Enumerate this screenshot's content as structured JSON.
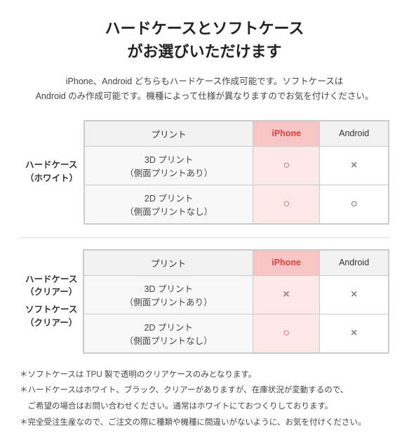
{
  "title": {
    "line1": "ハードケースとソフトケース",
    "line2": "がお選びいただけます"
  },
  "subtitle": "iPhone、Android どちらもハードケース作成可能です。ソフトケースは\nAndroid のみ作成可能です。機種によって仕様が異なりますのでお気を付けください。",
  "section1": {
    "row_header_line1": "ハードケース",
    "row_header_line2": "（ホワイト）",
    "col_print": "プリント",
    "col_iphone": "iPhone",
    "col_android": "Android",
    "rows": [
      {
        "print": "3D プリント\n（側面プリントあり）",
        "iphone": "○",
        "android": "×"
      },
      {
        "print": "2D プリント\n（側面プリントなし）",
        "iphone": "○",
        "android": "○"
      }
    ]
  },
  "section2": {
    "row_header_line1": "ハードケース",
    "row_header_line2": "（クリアー）",
    "row_header2_line1": "ソフトケース",
    "row_header2_line2": "（クリアー）",
    "col_print": "プリント",
    "col_iphone": "iPhone",
    "col_android": "Android",
    "rows": [
      {
        "print": "3D プリント\n（側面プリントあり）",
        "iphone": "×",
        "android": "×"
      },
      {
        "print": "2D プリント\n（側面プリントなし）",
        "iphone": "○",
        "android": "×"
      }
    ]
  },
  "notes": [
    "＊ソフトケースは TPU 製で透明のクリアケースのみとなります。",
    "＊ハードケースはホワイト、ブラック、クリアーがありますが、在庫状況が変動するので、",
    "　ご希望の場合はお問い合わせください。通常はホワイトにておつくりしております。",
    "＊完全受注生産なので、ご注文の際に種類や機種に間違いがないように、お気を付けください。"
  ],
  "colors": {
    "iphone_header_bg": "#f7c5c5",
    "iphone_cell_bg": "#fde8e8",
    "iphone_text": "#e04040",
    "table_border": "#ccc",
    "header_bg": "#f2f2f2"
  }
}
